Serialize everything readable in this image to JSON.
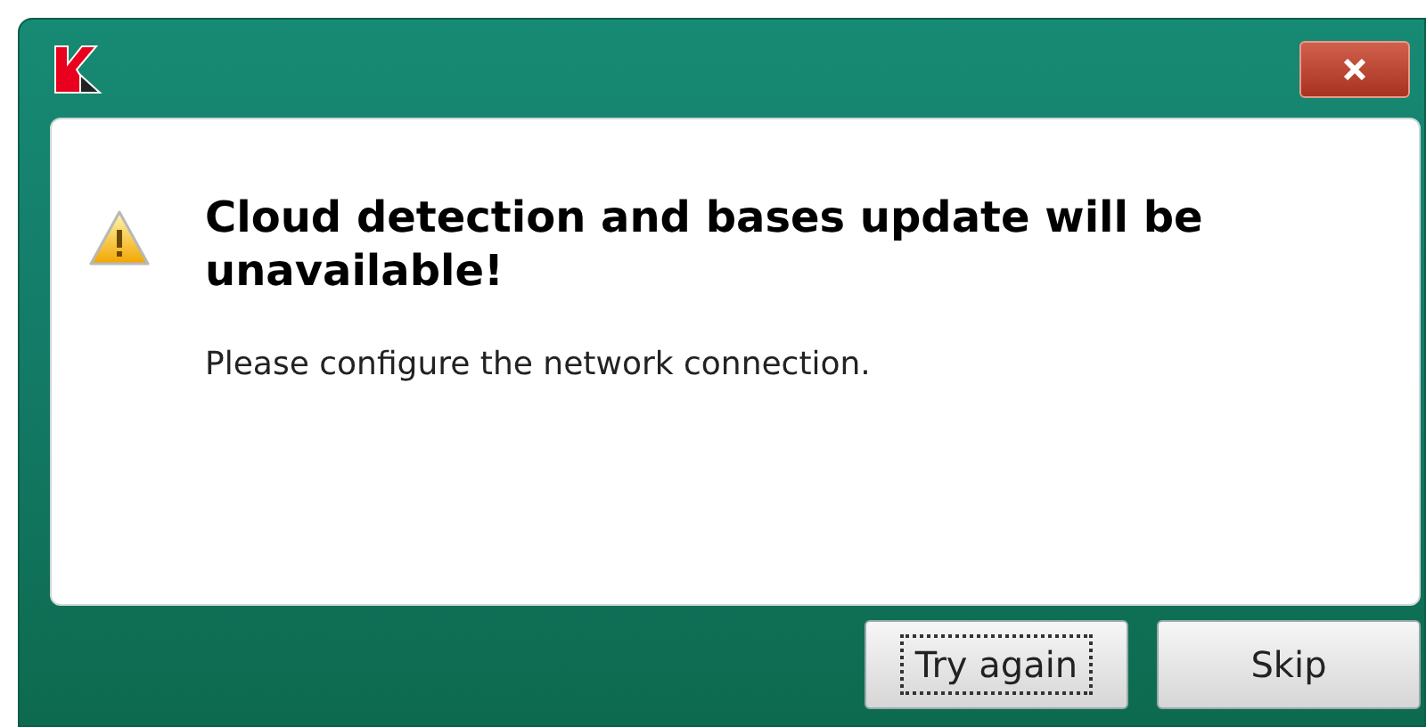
{
  "dialog": {
    "heading": "Cloud detection and bases update will be unavailable!",
    "message": "Please configure the network connection."
  },
  "buttons": [
    {
      "label": "Try again",
      "focused": true
    },
    {
      "label": "Skip",
      "focused": false
    }
  ]
}
